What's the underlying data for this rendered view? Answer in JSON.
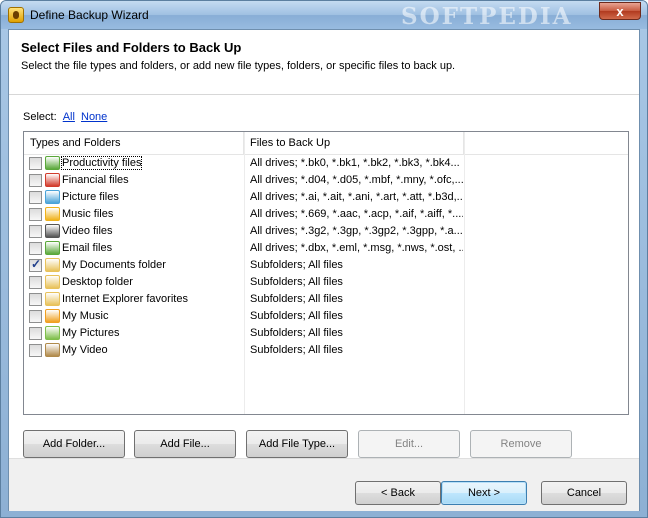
{
  "window": {
    "title": "Define Backup Wizard",
    "watermark": "SOFTPEDIA",
    "close_glyph": "x"
  },
  "header": {
    "title": "Select Files and Folders to Back Up",
    "subtitle": "Select the file types and folders, or add new file types, folders, or specific files to back up."
  },
  "select": {
    "label": "Select:",
    "all": "All",
    "none": "None"
  },
  "list": {
    "columns": [
      "Types and Folders",
      "Files to Back Up"
    ],
    "rows": [
      {
        "name": "Productivity files",
        "files": "All drives; *.bk0, *.bk1, *.bk2, *.bk3, *.bk4...",
        "checked": false,
        "icon": "productivity-icon",
        "icon_color": "#5aa83a"
      },
      {
        "name": "Financial files",
        "files": "All drives; *.d04, *.d05, *.mbf, *.mny, *.ofc,...",
        "checked": false,
        "icon": "financial-chart-icon",
        "icon_color": "#d23b2c"
      },
      {
        "name": "Picture files",
        "files": "All drives; *.ai, *.ait, *.ani, *.art, *.att, *.b3d,...",
        "checked": false,
        "icon": "picture-icon",
        "icon_color": "#4aa3d8"
      },
      {
        "name": "Music files",
        "files": "All drives; *.669, *.aac, *.acp, *.aif, *.aiff, *....",
        "checked": false,
        "icon": "music-icon",
        "icon_color": "#f0b21a"
      },
      {
        "name": "Video files",
        "files": "All drives; *.3g2, *.3gp, *.3gp2, *.3gpp, *.a...",
        "checked": false,
        "icon": "video-film-icon",
        "icon_color": "#555555"
      },
      {
        "name": "Email files",
        "files": "All drives; *.dbx, *.eml, *.msg, *.nws, *.ost, ...",
        "checked": false,
        "icon": "email-icon",
        "icon_color": "#5aa83a"
      },
      {
        "name": "My Documents folder",
        "files": "Subfolders; All files",
        "checked": true,
        "icon": "documents-folder-icon",
        "icon_color": "#e8c25a"
      },
      {
        "name": "Desktop folder",
        "files": "Subfolders; All files",
        "checked": false,
        "icon": "desktop-folder-icon",
        "icon_color": "#e8c25a"
      },
      {
        "name": "Internet Explorer favorites",
        "files": "Subfolders; All files",
        "checked": false,
        "icon": "favorites-folder-icon",
        "icon_color": "#e8c25a"
      },
      {
        "name": "My Music",
        "files": "Subfolders; All files",
        "checked": false,
        "icon": "music-folder-icon",
        "icon_color": "#f0a020"
      },
      {
        "name": "My Pictures",
        "files": "Subfolders; All files",
        "checked": false,
        "icon": "pictures-folder-icon",
        "icon_color": "#7fbf4a"
      },
      {
        "name": "My Video",
        "files": "Subfolders; All files",
        "checked": false,
        "icon": "video-folder-icon",
        "icon_color": "#b08a4a"
      }
    ]
  },
  "actions": {
    "add_folder": "Add Folder...",
    "add_file": "Add File...",
    "add_file_type": "Add File Type...",
    "edit": "Edit...",
    "remove": "Remove"
  },
  "nav": {
    "back": "< Back",
    "next": "Next >",
    "cancel": "Cancel"
  }
}
